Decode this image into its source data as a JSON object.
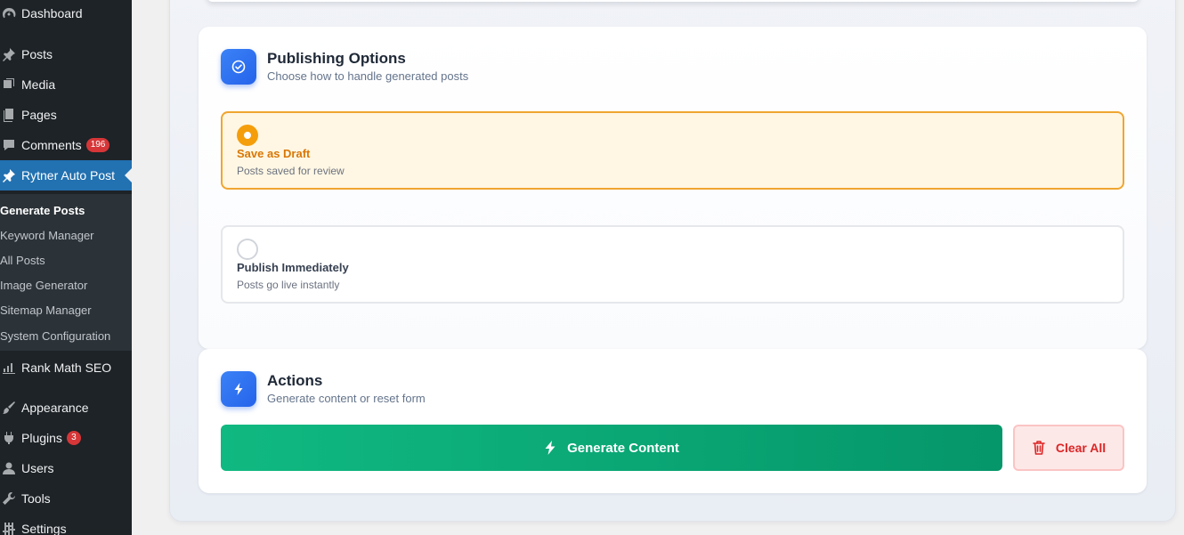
{
  "sidebar": {
    "items": [
      {
        "label": "Dashboard",
        "icon": "dashboard-icon"
      },
      {
        "label": "Posts",
        "icon": "pin-icon"
      },
      {
        "label": "Media",
        "icon": "media-icon"
      },
      {
        "label": "Pages",
        "icon": "pages-icon"
      },
      {
        "label": "Comments",
        "icon": "comment-icon",
        "badge": "196"
      },
      {
        "label": "Rytner Auto Post",
        "icon": "pin-icon",
        "active": true
      },
      {
        "label": "Rank Math SEO",
        "icon": "chart-icon"
      },
      {
        "label": "Appearance",
        "icon": "brush-icon"
      },
      {
        "label": "Plugins",
        "icon": "plugin-icon",
        "badge": "3"
      },
      {
        "label": "Users",
        "icon": "user-icon"
      },
      {
        "label": "Tools",
        "icon": "wrench-icon"
      },
      {
        "label": "Settings",
        "icon": "settings-icon"
      }
    ],
    "submenu": [
      {
        "label": "Generate Posts",
        "current": true
      },
      {
        "label": "Keyword Manager"
      },
      {
        "label": "All Posts"
      },
      {
        "label": "Image Generator"
      },
      {
        "label": "Sitemap Manager"
      },
      {
        "label": "System Configuration"
      }
    ]
  },
  "publishing": {
    "title": "Publishing Options",
    "subtitle": "Choose how to handle generated posts",
    "icon": "check-circle-icon",
    "options": [
      {
        "title": "Save as Draft",
        "desc": "Posts saved for review",
        "selected": true
      },
      {
        "title": "Publish Immediately",
        "desc": "Posts go live instantly",
        "selected": false
      }
    ]
  },
  "actions": {
    "title": "Actions",
    "subtitle": "Generate content or reset form",
    "icon": "bolt-icon",
    "generate_label": "Generate Content",
    "clear_label": "Clear All"
  },
  "colors": {
    "sidebar_bg": "#1d2327",
    "active_menu": "#2271b1",
    "accent_blue": "#2563eb",
    "draft_orange": "#f59e0b",
    "generate_green": "#10b981",
    "clear_red": "#dc2626"
  }
}
